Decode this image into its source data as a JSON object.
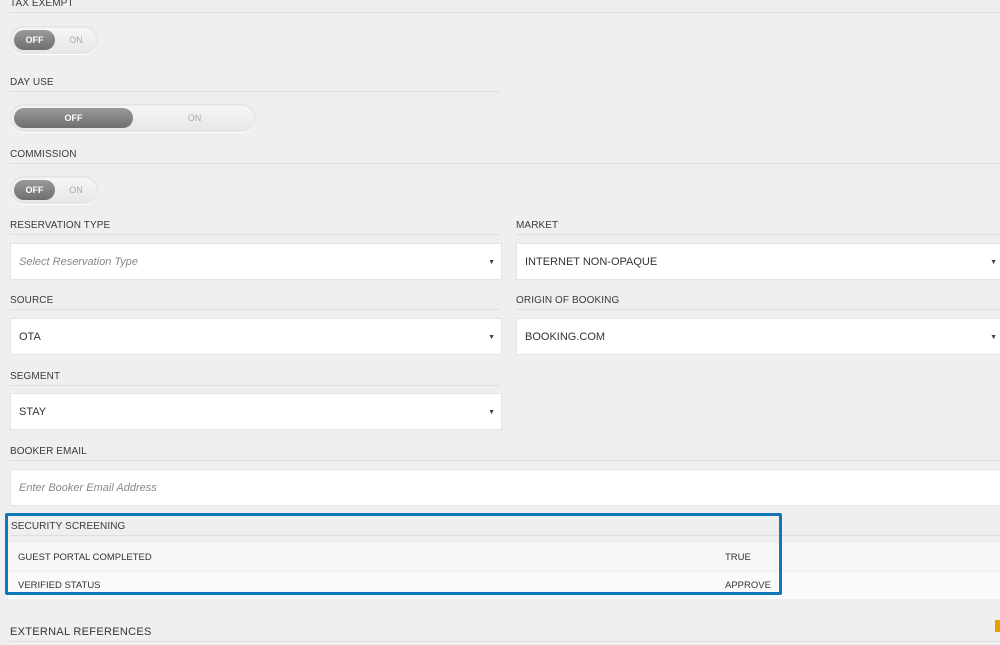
{
  "fields": {
    "tax_exempt": {
      "label": "TAX EXEMPT",
      "off": "OFF",
      "on": "ON"
    },
    "day_use": {
      "label": "DAY USE",
      "off": "OFF",
      "on": "ON"
    },
    "commission": {
      "label": "COMMISSION",
      "off": "OFF",
      "on": "ON"
    },
    "reservation_type": {
      "label": "RESERVATION TYPE",
      "placeholder": "Select Reservation Type"
    },
    "market": {
      "label": "MARKET",
      "value": "INTERNET NON-OPAQUE"
    },
    "source": {
      "label": "SOURCE",
      "value": "OTA"
    },
    "origin_of_booking": {
      "label": "ORIGIN OF BOOKING",
      "value": "BOOKING.COM"
    },
    "segment": {
      "label": "SEGMENT",
      "value": "STAY"
    },
    "booker_email": {
      "label": "BOOKER EMAIL",
      "placeholder": "Enter Booker Email Address"
    }
  },
  "security_screening": {
    "title": "SECURITY SCREENING",
    "rows": [
      {
        "key": "GUEST PORTAL COMPLETED",
        "value": "TRUE"
      },
      {
        "key": "VERIFIED STATUS",
        "value": "APPROVE"
      }
    ]
  },
  "external_references": {
    "title": "EXTERNAL REFERENCES"
  },
  "colors": {
    "highlight": "#1177bb",
    "toggle_knob": "#7d7d7d",
    "accent_edge": "#e8a000"
  },
  "icons": {
    "dropdown": "caret-down-icon"
  }
}
